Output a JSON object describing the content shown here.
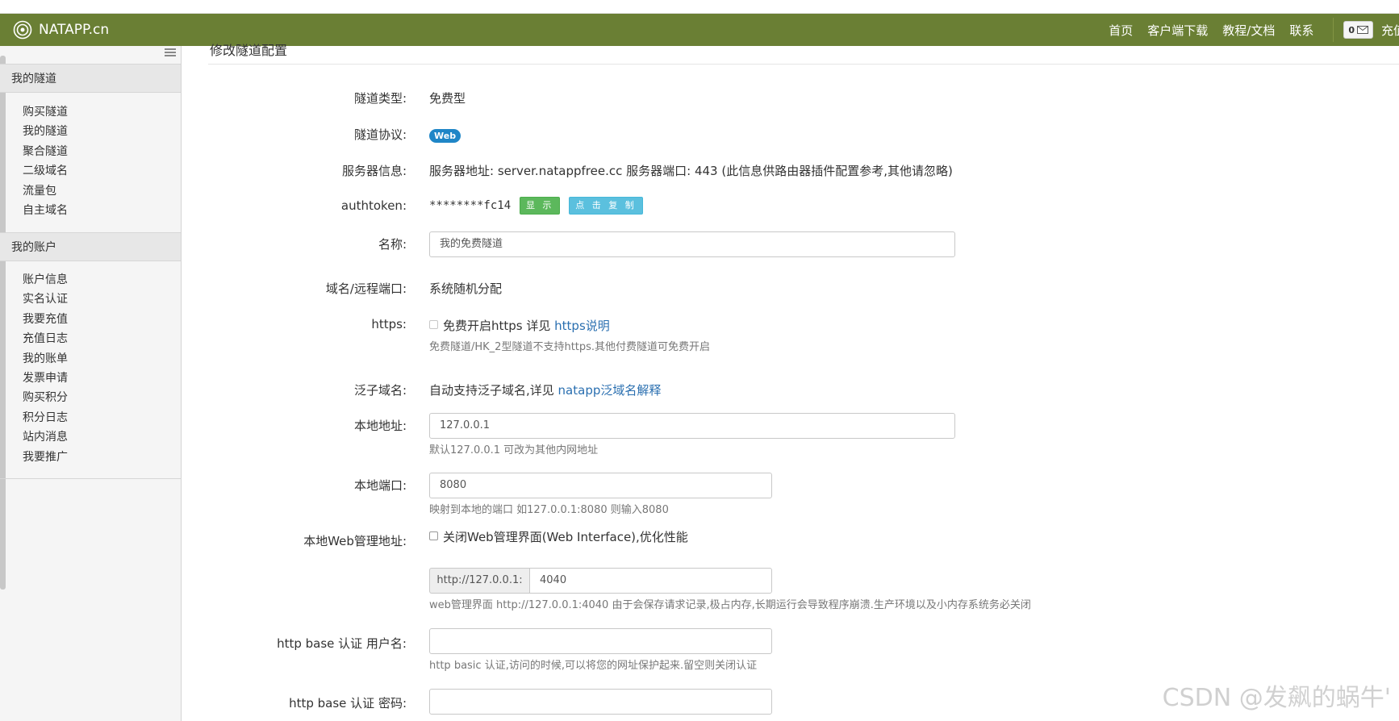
{
  "brand": {
    "name": "NATAPP.cn"
  },
  "nav": {
    "links": [
      "首页",
      "客户端下载",
      "教程/文档",
      "联系"
    ],
    "message_count": "0",
    "recharge_cut": "充值"
  },
  "sidebar": {
    "section1": {
      "title": "我的隧道",
      "items": [
        "购买隧道",
        "我的隧道",
        "聚合隧道",
        "二级域名",
        "流量包",
        "自主域名"
      ]
    },
    "section2": {
      "title": "我的账户",
      "items": [
        "账户信息",
        "实名认证",
        "我要充值",
        "充值日志",
        "我的账单",
        "发票申请",
        "购买积分",
        "积分日志",
        "站内消息",
        "我要推广"
      ]
    }
  },
  "page": {
    "title": "修改隧道配置"
  },
  "form": {
    "type": {
      "label": "隧道类型:",
      "value": "免费型"
    },
    "protocol": {
      "label": "隧道协议:",
      "badge": "Web"
    },
    "server": {
      "label": "服务器信息:",
      "value": "服务器地址: server.natappfree.cc 服务器端口: 443 (此信息供路由器插件配置参考,其他请忽略)"
    },
    "authtoken": {
      "label": "authtoken:",
      "value": "********fc14",
      "show_btn": "显 示",
      "copy_btn": "点 击 复 制"
    },
    "name": {
      "label": "名称:",
      "value": "我的免费隧道"
    },
    "domain": {
      "label": "域名/远程端口:",
      "value": "系统随机分配"
    },
    "https": {
      "label": "https:",
      "text": "免费开启https 详见 ",
      "link": "https说明",
      "help": "免费隧道/HK_2型隧道不支持https.其他付费隧道可免费开启"
    },
    "wildcard": {
      "label": "泛子域名:",
      "text": "自动支持泛子域名,详见 ",
      "link": "natapp泛域名解释"
    },
    "local_addr": {
      "label": "本地地址:",
      "value": "127.0.0.1",
      "help": "默认127.0.0.1 可改为其他内网地址"
    },
    "local_port": {
      "label": "本地端口:",
      "value": "8080",
      "help": "映射到本地的端口 如127.0.0.1:8080 则输入8080"
    },
    "web_admin": {
      "label": "本地Web管理地址:",
      "checkbox": "关闭Web管理界面(Web Interface),优化性能",
      "prefix": "http://127.0.0.1:",
      "port": "4040",
      "help": "web管理界面 http://127.0.0.1:4040 由于会保存请求记录,极占内存,长期运行会导致程序崩溃.生产环境以及小内存系统务必关闭"
    },
    "basic_user": {
      "label": "http base 认证 用户名:",
      "value": "",
      "help": "http basic 认证,访问的时候,可以将您的网址保护起来.留空则关闭认证"
    },
    "basic_pass": {
      "label": "http base 认证 密码:",
      "value": ""
    }
  },
  "watermark": "CSDN @发飙的蜗牛'"
}
